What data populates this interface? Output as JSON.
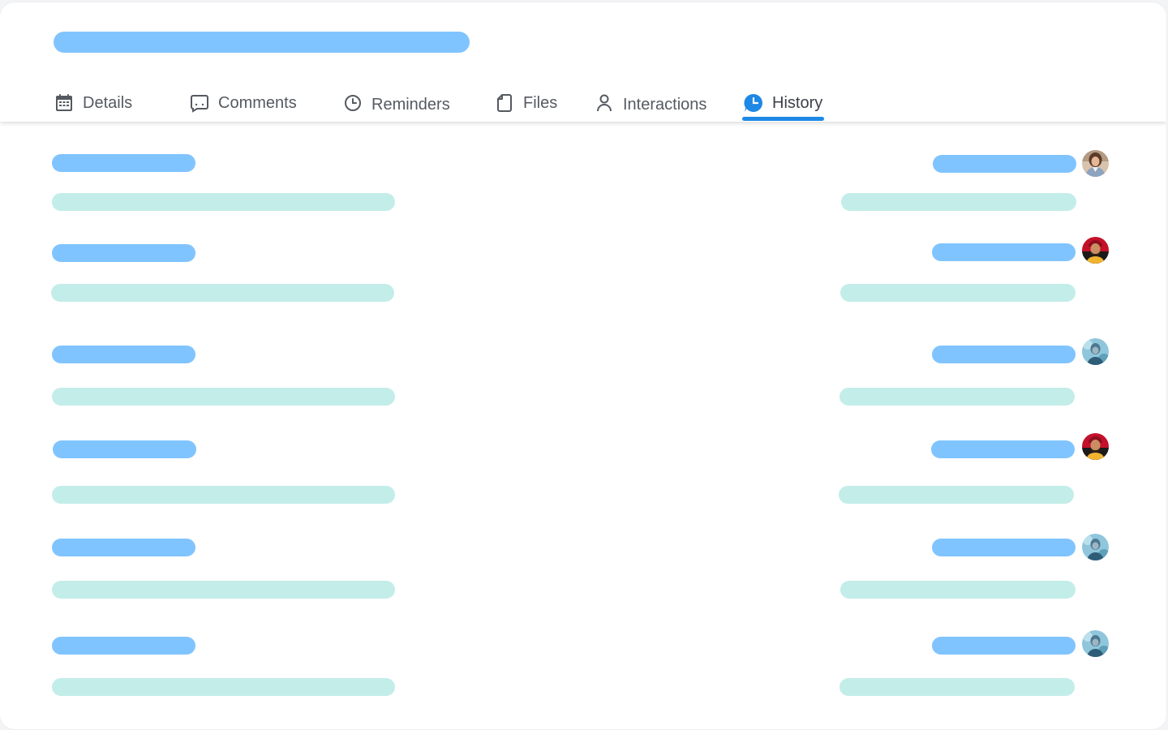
{
  "tabs": [
    {
      "label": "Details",
      "icon": "calendar-icon"
    },
    {
      "label": "Comments",
      "icon": "comment-icon"
    },
    {
      "label": "Reminders",
      "icon": "clock-icon"
    },
    {
      "label": "Files",
      "icon": "file-icon"
    },
    {
      "label": "Interactions",
      "icon": "person-icon"
    },
    {
      "label": "History",
      "icon": "history-icon",
      "active": true
    }
  ],
  "colors": {
    "accent": "#1e88e5",
    "placeholder_primary": "#80c4ff",
    "placeholder_secondary": "#c3ede9",
    "tab_text": "#555a61"
  },
  "history": {
    "entries": [
      {
        "avatar": "avatar-woman"
      },
      {
        "avatar": "avatar-man-red-cap"
      },
      {
        "avatar": "avatar-man-blue"
      },
      {
        "avatar": "avatar-man-red-cap"
      },
      {
        "avatar": "avatar-man-blue"
      },
      {
        "avatar": "avatar-man-blue"
      }
    ]
  }
}
